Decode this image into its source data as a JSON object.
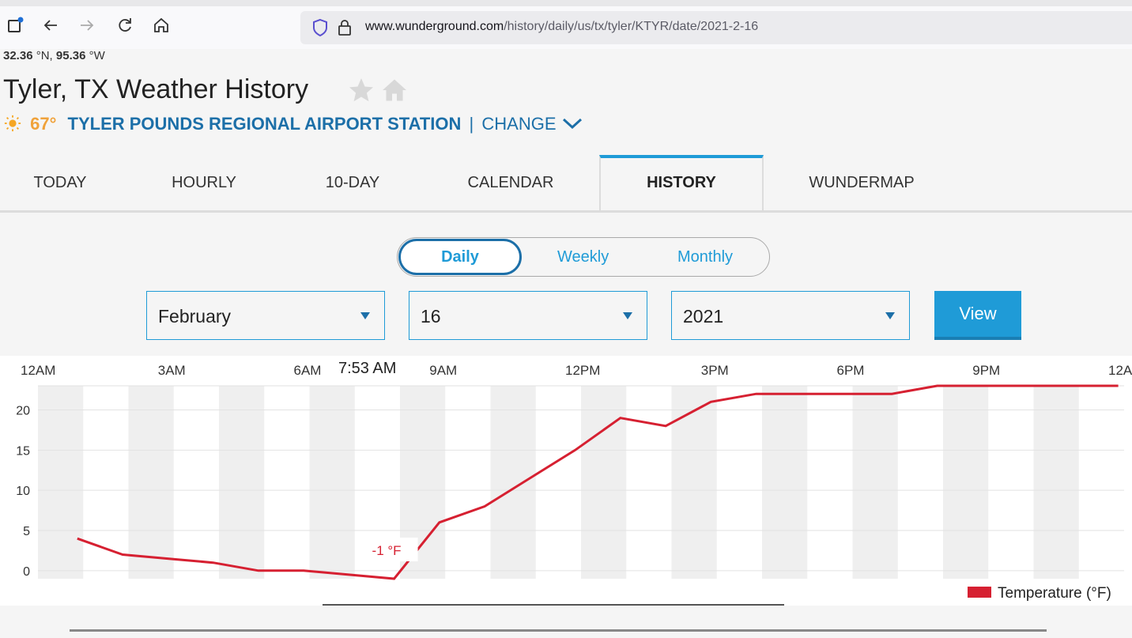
{
  "browser": {
    "url_domain": "www.wunderground.com",
    "url_path": "/history/daily/us/tx/tyler/KTYR/date/2021-2-16"
  },
  "location": {
    "lat": "32.36",
    "lat_unit": "°N,",
    "lon": "95.36",
    "lon_unit": "°W",
    "title": "Tyler, TX Weather History",
    "current_temp": "67°",
    "station_name": "TYLER POUNDS REGIONAL AIRPORT STATION",
    "separator": "|",
    "change_label": "CHANGE"
  },
  "tabs": [
    {
      "label": "TODAY"
    },
    {
      "label": "HOURLY"
    },
    {
      "label": "10-DAY"
    },
    {
      "label": "CALENDAR"
    },
    {
      "label": "HISTORY",
      "active": true
    },
    {
      "label": "WUNDERMAP"
    }
  ],
  "period_toggle": {
    "daily": "Daily",
    "weekly": "Weekly",
    "monthly": "Monthly"
  },
  "filters": {
    "month": "February",
    "day": "16",
    "year": "2021",
    "view_label": "View"
  },
  "colors": {
    "accent": "#1f9bd7",
    "line": "#d62031"
  },
  "chart_data": {
    "type": "line",
    "x_ticks": [
      "12AM",
      "3AM",
      "6AM",
      "9AM",
      "12PM",
      "3PM",
      "6PM",
      "9PM",
      "12AM"
    ],
    "cursor_time": "7:53 AM",
    "y_ticks": [
      0,
      5,
      10,
      15,
      20
    ],
    "ylim": [
      -1,
      23
    ],
    "x_range_hours": [
      0,
      24
    ],
    "grid": true,
    "legend": "bottom-right",
    "min_label": "-1 °F",
    "series": [
      {
        "name": "Temperature (°F)",
        "x_hours": [
          0.87,
          1.87,
          2.87,
          3.87,
          4.87,
          5.87,
          6.87,
          7.87,
          8.87,
          9.87,
          10.87,
          11.87,
          12.87,
          13.87,
          14.87,
          15.87,
          16.87,
          17.87,
          18.87,
          19.87,
          20.87,
          21.87,
          22.87,
          23.87
        ],
        "values": [
          4,
          2,
          1.5,
          1,
          0,
          0,
          -0.5,
          -1,
          6,
          8,
          11.5,
          15,
          19,
          18,
          21,
          22,
          22,
          22,
          22,
          23,
          23,
          23,
          23,
          23
        ]
      }
    ]
  }
}
